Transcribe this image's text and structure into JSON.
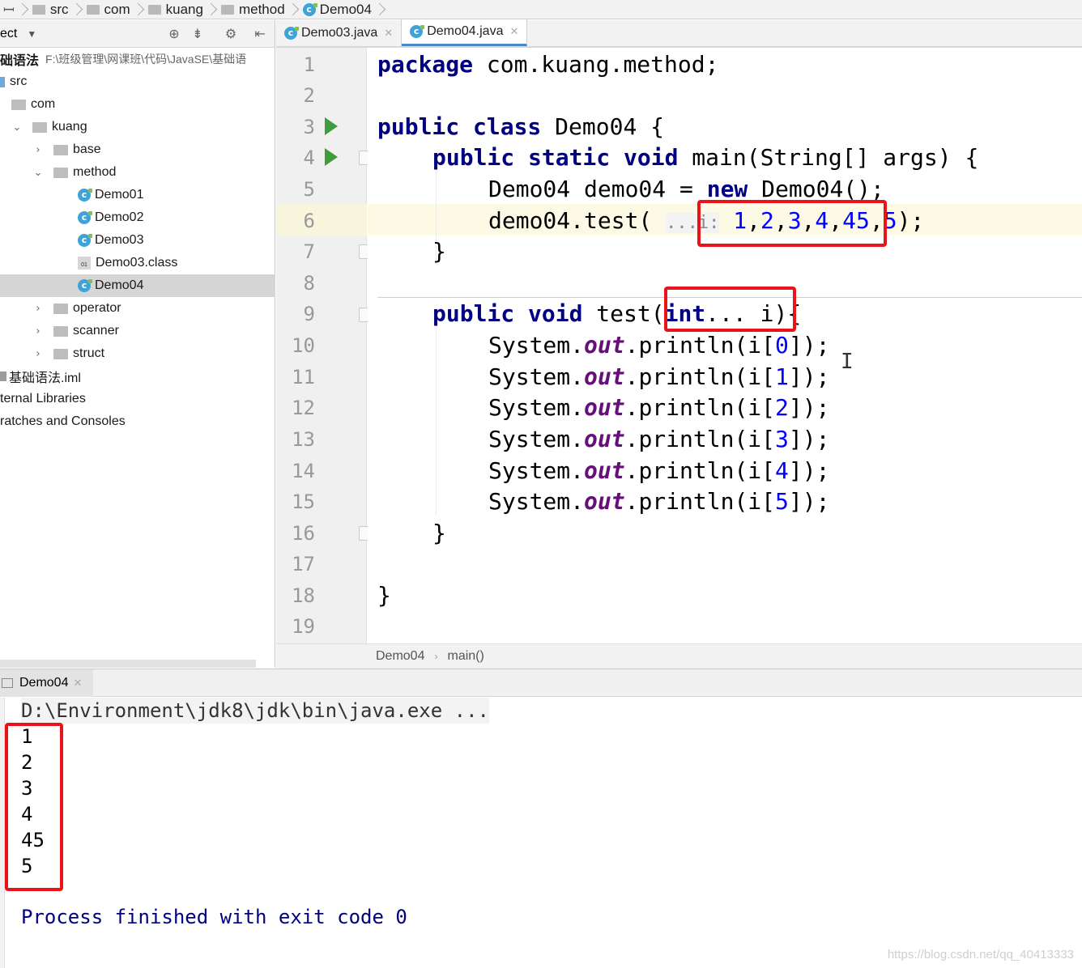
{
  "navbar": {
    "items": [
      {
        "label": "src",
        "icon": "folder-icon"
      },
      {
        "label": "com",
        "icon": "folder-icon"
      },
      {
        "label": "kuang",
        "icon": "folder-icon"
      },
      {
        "label": "method",
        "icon": "folder-icon"
      },
      {
        "label": "Demo04",
        "icon": "class-icon"
      }
    ]
  },
  "project": {
    "title": "ect",
    "root_name": "础语法",
    "root_path": "F:\\班级管理\\网课班\\代码\\JavaSE\\基础语",
    "tree": [
      {
        "label": "src"
      },
      {
        "label": "com"
      },
      {
        "label": "kuang"
      },
      {
        "label": "base"
      },
      {
        "label": "method"
      },
      {
        "label": "Demo01"
      },
      {
        "label": "Demo02"
      },
      {
        "label": "Demo03"
      },
      {
        "label": "Demo03.class"
      },
      {
        "label": "Demo04"
      },
      {
        "label": "operator"
      },
      {
        "label": "scanner"
      },
      {
        "label": "struct"
      },
      {
        "label": "基础语法.iml"
      },
      {
        "label": "ternal Libraries"
      },
      {
        "label": "ratches and Consoles"
      }
    ]
  },
  "tabs": [
    {
      "label": "Demo03.java"
    },
    {
      "label": "Demo04.java"
    }
  ],
  "editor": {
    "line_numbers": [
      "1",
      "2",
      "3",
      "4",
      "5",
      "6",
      "7",
      "8",
      "9",
      "10",
      "11",
      "12",
      "13",
      "14",
      "15",
      "16",
      "17",
      "18",
      "19"
    ],
    "current_line": 6,
    "code": {
      "l1_kw": "package",
      "l1_rest": " com.kuang.method;",
      "l3_kw": "public class",
      "l3_rest": " Demo04 {",
      "l4_kw": "public static void",
      "l4_rest": " main(String[] args) {",
      "l5_a": "Demo04 demo04 = ",
      "l5_kw": "new",
      "l5_b": " Demo04();",
      "l6_a": "demo04.test( ",
      "l6_hint": "...i:",
      "l6_args": [
        "1",
        "2",
        "3",
        "4",
        "45",
        "5"
      ],
      "l6_end": ");",
      "l7": "}",
      "l9_kw1": "public void",
      "l9_a": " test(",
      "l9_kw2": "int",
      "l9_b": "... i){",
      "println_prefix": "System.",
      "println_field": "out",
      "println_mid": ".println(i[",
      "println_suffix": "]);",
      "println_indices": [
        "0",
        "1",
        "2",
        "3",
        "4",
        "5"
      ],
      "l16": "}",
      "l18": "}"
    }
  },
  "editor_breadcrumb": {
    "class": "Demo04",
    "method": "main()"
  },
  "run": {
    "tab_label": "Demo04",
    "command": "D:\\Environment\\jdk8\\jdk\\bin\\java.exe ...",
    "output": [
      "1",
      "2",
      "3",
      "4",
      "45",
      "5"
    ],
    "finished": "Process finished with exit code 0"
  },
  "watermark": "https://blog.csdn.net/qq_40413333",
  "colors": {
    "accent": "#4a88c7",
    "highlight_box": "#e8141a",
    "keyword": "#000080",
    "number": "#0000ff",
    "field": "#660e7a"
  }
}
